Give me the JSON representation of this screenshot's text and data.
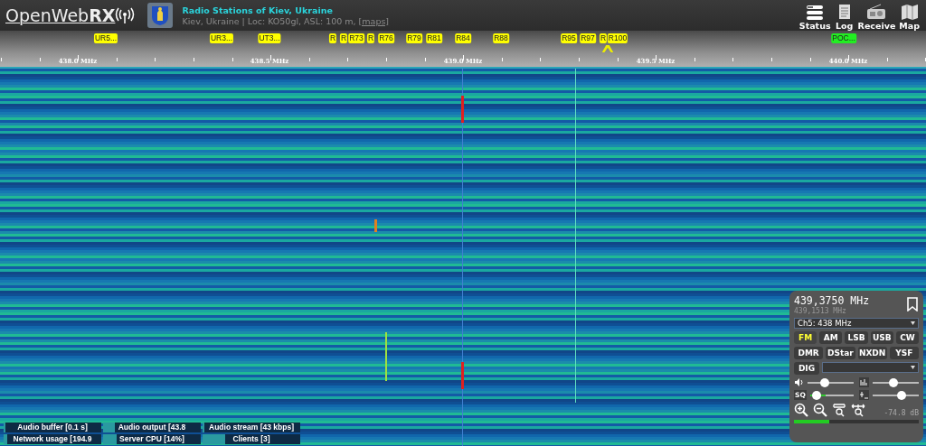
{
  "header": {
    "logo": "OpenWeb**RX**",
    "title": "Radio Stations of Kiev, Ukraine",
    "subtitle": "Kiev, Ukraine | Loc: KO50gl, ASL: 100 m,",
    "maps_link": "[maps]",
    "buttons": [
      {
        "label": "Status"
      },
      {
        "label": "Log"
      },
      {
        "label": "Receive"
      },
      {
        "label": "Map"
      }
    ]
  },
  "bookmarks": [
    {
      "label": "UR5...",
      "color": "#ffff00"
    },
    {
      "label": "UR3...",
      "color": "#ffff00"
    },
    {
      "label": "UT3...",
      "color": "#ffff00"
    },
    {
      "label": "R",
      "color": "#ffff00"
    },
    {
      "label": "R",
      "color": "#ffff00"
    },
    {
      "label": "R73",
      "color": "#ffff00"
    },
    {
      "label": "R",
      "color": "#ffff00"
    },
    {
      "label": "R76",
      "color": "#ffff00"
    },
    {
      "label": "R79",
      "color": "#ffff00"
    },
    {
      "label": "R81",
      "color": "#ffff00"
    },
    {
      "label": "R84",
      "color": "#ffff00"
    },
    {
      "label": "R88",
      "color": "#ffff00"
    },
    {
      "label": "R95",
      "color": "#ffff00"
    },
    {
      "label": "R97",
      "color": "#ffff00"
    },
    {
      "label": "R",
      "color": "#ffff00"
    },
    {
      "label": "R100",
      "color": "#ffff00"
    },
    {
      "label": "POC...",
      "color": "#22ee22"
    }
  ],
  "scale_labels": [
    "438.0 MHz",
    "438.5 MHz",
    "439.0 MHz",
    "439.5 MHz",
    "440.0 MHz"
  ],
  "receiver": {
    "frequency": "439,3750 MHz",
    "offset_frequency": "439,1513 MHz",
    "bookmark_select": "Ch5: 438 MHz",
    "modes": [
      [
        {
          "label": "FM",
          "selected": true
        },
        {
          "label": "AM",
          "selected": false
        },
        {
          "label": "LSB",
          "selected": false
        },
        {
          "label": "USB",
          "selected": false
        },
        {
          "label": "CW",
          "selected": false
        }
      ],
      [
        {
          "label": "DMR",
          "selected": false
        },
        {
          "label": "DStar",
          "selected": false
        },
        {
          "label": "NXDN",
          "selected": false
        },
        {
          "label": "YSF",
          "selected": false
        }
      ],
      [
        {
          "label": "DIG",
          "selected": false
        }
      ]
    ],
    "sliders": [
      {
        "kind": "volume",
        "level": 0.35
      },
      {
        "kind": "noise",
        "level": 0.45
      },
      {
        "kind": "squelch",
        "label": "SQ",
        "level": 0.05
      },
      {
        "kind": "gain",
        "level": 0.66
      }
    ],
    "signal_reading": "-74.8 dB",
    "signal": {
      "level": 0.28
    }
  },
  "status": [
    {
      "label": "Audio buffer [0.1 s]",
      "level": 0.02
    },
    {
      "label": "Audio output [43.8",
      "level": 0.12
    },
    {
      "label": "Audio stream [43 kbps]",
      "level": 0.02
    },
    {
      "label": "Network usage [194.9",
      "level": 0.04
    },
    {
      "label": "Server CPU [14%]",
      "level": 0.14
    },
    {
      "label": "Clients [3]",
      "level": 0.23
    }
  ]
}
